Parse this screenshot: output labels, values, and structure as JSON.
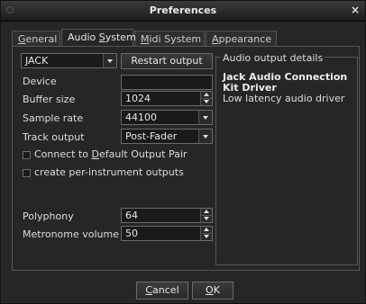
{
  "window": {
    "title": "Preferences",
    "close_glyph": "×"
  },
  "tabs": [
    {
      "pre": "",
      "mn": "G",
      "post": "eneral",
      "active": false
    },
    {
      "pre": "Audio ",
      "mn": "S",
      "post": "ystem",
      "active": true
    },
    {
      "pre": "",
      "mn": "M",
      "post": "idi System",
      "active": false
    },
    {
      "pre": "",
      "mn": "A",
      "post": "ppearance",
      "active": false
    }
  ],
  "audio": {
    "driver_value": "JACK",
    "restart_label": "Restart output",
    "device_label": "Device",
    "device_value": "",
    "buffer_label": "Buffer size",
    "buffer_value": "1024",
    "samplerate_label": "Sample rate",
    "samplerate_value": "44100",
    "track_label": "Track output",
    "track_value": "Post-Fader",
    "connect_pre": "Connect to ",
    "connect_mn": "D",
    "connect_post": "efault Output Pair",
    "per_instrument_label": "create per-instrument outputs",
    "polyphony_label": "Polyphony",
    "polyphony_value": "64",
    "metronome_label": "Metronome volume",
    "metronome_value": "50"
  },
  "details": {
    "group_title": "Audio output details",
    "driver_name": "Jack Audio Connection Kit Driver",
    "driver_desc": "Low latency audio driver"
  },
  "buttons": {
    "cancel_mn": "C",
    "cancel_post": "ancel",
    "ok_mn": "O",
    "ok_post": "K"
  }
}
